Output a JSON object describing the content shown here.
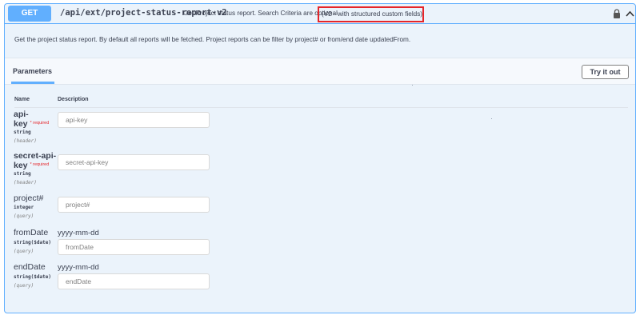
{
  "operation": {
    "method": "GET",
    "path": "/api/ext/project-status-report-v2",
    "summary": "Get Project status report. Search Criteria are optional",
    "summary_note": "(V2 - with structured custom fields)",
    "description": "Get the project status report. By default all reports will be fetched. Project reports can be filter by project# or from/end date updatedFrom."
  },
  "parameters_section": {
    "tab_label": "Parameters",
    "try_it_out_label": "Try it out",
    "column_name": "Name",
    "column_description": "Description",
    "required_label": "* required",
    "items": [
      {
        "name_line1": "api-",
        "name_line2": "key",
        "type": "string",
        "in": "(header)",
        "placeholder": "api-key",
        "format": ""
      },
      {
        "name_line1": "secret-api-",
        "name_line2": "key",
        "type": "string",
        "in": "(header)",
        "placeholder": "secret-api-key",
        "format": ""
      },
      {
        "name": "project#",
        "type": "integer",
        "in": "(query)",
        "placeholder": "project#",
        "format": ""
      },
      {
        "name": "fromDate",
        "type": "string($date)",
        "in": "(query)",
        "placeholder": "fromDate",
        "format": "yyyy-mm-dd"
      },
      {
        "name": "endDate",
        "type": "string($date)",
        "in": "(query)",
        "placeholder": "endDate",
        "format": "yyyy-mm-dd"
      }
    ]
  },
  "colors": {
    "method_badge": "#61affe",
    "block_background": "#ebf3fb",
    "highlight_border": "#e5252a",
    "required": "#e5252a"
  },
  "icons": [
    "lock-icon",
    "chevron-up-icon"
  ]
}
